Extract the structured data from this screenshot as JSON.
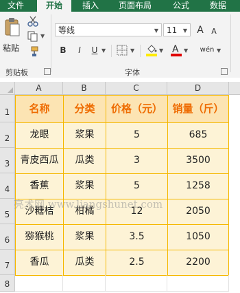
{
  "tabs": [
    "文件",
    "开始",
    "插入",
    "页面布局",
    "公式",
    "数据"
  ],
  "active_tab": "开始",
  "clipboard": {
    "paste_label": "粘贴",
    "group_label": "剪贴板"
  },
  "font": {
    "name": "等线",
    "size": "11",
    "group_label": "字体",
    "bold": "B",
    "italic": "I",
    "underline": "U",
    "grow": "A",
    "shrink": "A",
    "phonetic": "wén"
  },
  "colors": {
    "accent": "#217346",
    "header_text": "#ee6b00",
    "table_border": "#f5b800",
    "header_fill": "#fce4b3",
    "cell_fill": "#fdf3d6",
    "font_color_bar": "#e00000",
    "fill_color_bar": "#ffeb00"
  },
  "columns": [
    "A",
    "B",
    "C",
    "D"
  ],
  "rows": [
    "1",
    "2",
    "3",
    "4",
    "5",
    "6",
    "7",
    "8"
  ],
  "table": {
    "headers": [
      "名称",
      "分类",
      "价格（元）",
      "销量（斤）"
    ],
    "data": [
      [
        "龙眼",
        "浆果",
        "5",
        "685"
      ],
      [
        "青皮西瓜",
        "瓜类",
        "3",
        "3500"
      ],
      [
        "香蕉",
        "浆果",
        "5",
        "1258"
      ],
      [
        "沙糖桔",
        "柑橘",
        "12",
        "2050"
      ],
      [
        "猕猴桃",
        "浆果",
        "3.5",
        "1050"
      ],
      [
        "香瓜",
        "瓜类",
        "2.5",
        "2200"
      ]
    ]
  },
  "watermark": "亮术网 www.liangshunet.com"
}
